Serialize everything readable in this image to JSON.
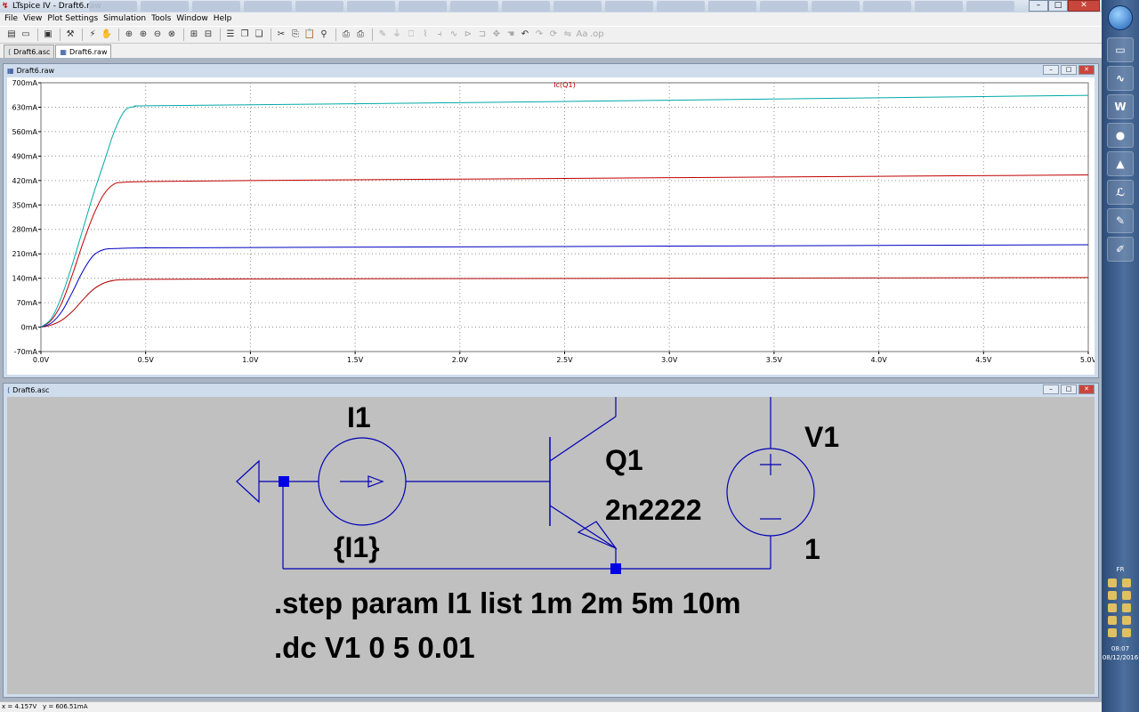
{
  "window": {
    "title": "LTspice IV - Draft6.raw",
    "controls": [
      "–",
      "□",
      "✕"
    ]
  },
  "menu": [
    "File",
    "View",
    "Plot Settings",
    "Simulation",
    "Tools",
    "Window",
    "Help"
  ],
  "tabs": [
    {
      "label": "Draft6.asc",
      "active": false
    },
    {
      "label": "Draft6.raw",
      "active": true
    }
  ],
  "plot_window": {
    "title": "Draft6.raw"
  },
  "schematic_window": {
    "title": "Draft6.asc"
  },
  "chart_data": {
    "type": "line",
    "title": "Ic(Q1)",
    "xlim": [
      0,
      5
    ],
    "ylim": [
      -70,
      700
    ],
    "x_ticks": [
      "0.0V",
      "0.5V",
      "1.0V",
      "1.5V",
      "2.0V",
      "2.5V",
      "3.0V",
      "3.5V",
      "4.0V",
      "4.5V",
      "5.0V"
    ],
    "y_ticks": [
      "-70mA",
      "0mA",
      "70mA",
      "140mA",
      "210mA",
      "280mA",
      "350mA",
      "420mA",
      "490mA",
      "560mA",
      "630mA",
      "700mA"
    ],
    "grid": true,
    "colors": [
      "#b00000",
      "#0000c0",
      "#c00000",
      "#00a8a8"
    ],
    "series": [
      {
        "x": [
          0,
          0.05,
          0.1,
          0.15,
          0.2,
          0.25,
          0.3,
          0.35,
          0.4,
          0.5,
          1,
          2,
          3,
          4,
          5
        ],
        "y": [
          0,
          6,
          20,
          45,
          78,
          108,
          126,
          134,
          136,
          137,
          138,
          139,
          140,
          141,
          142
        ]
      },
      {
        "x": [
          0,
          0.05,
          0.1,
          0.15,
          0.2,
          0.25,
          0.3,
          0.35,
          0.4,
          0.5,
          1,
          2,
          3,
          4,
          5
        ],
        "y": [
          0,
          12,
          45,
          100,
          160,
          205,
          222,
          225,
          226,
          227,
          228,
          230,
          232,
          234,
          236
        ]
      },
      {
        "x": [
          0,
          0.05,
          0.1,
          0.15,
          0.2,
          0.25,
          0.3,
          0.35,
          0.4,
          0.5,
          1,
          2,
          3,
          4,
          5
        ],
        "y": [
          0,
          20,
          70,
          150,
          240,
          320,
          380,
          410,
          415,
          417,
          420,
          424,
          428,
          432,
          436
        ]
      },
      {
        "x": [
          0,
          0.05,
          0.1,
          0.15,
          0.2,
          0.25,
          0.3,
          0.35,
          0.4,
          0.45,
          0.5,
          1,
          2,
          3,
          4,
          5
        ],
        "y": [
          0,
          25,
          90,
          180,
          280,
          380,
          470,
          560,
          620,
          632,
          634,
          637,
          643,
          650,
          657,
          664
        ]
      }
    ]
  },
  "schematic": {
    "current_source": {
      "name": "I1",
      "value": "{I1}"
    },
    "transistor": {
      "name": "Q1",
      "model": "2n2222"
    },
    "voltage_source": {
      "name": "V1",
      "value": "1"
    },
    "directives": [
      ".step param I1 list 1m 2m 5m 10m",
      ".dc V1 0 5 0.01"
    ]
  },
  "status": {
    "x": "x = 4.157V",
    "y": "y = 606.51mA"
  },
  "tray": {
    "lang": "FR",
    "time": "08:07",
    "date": "08/12/2016"
  }
}
